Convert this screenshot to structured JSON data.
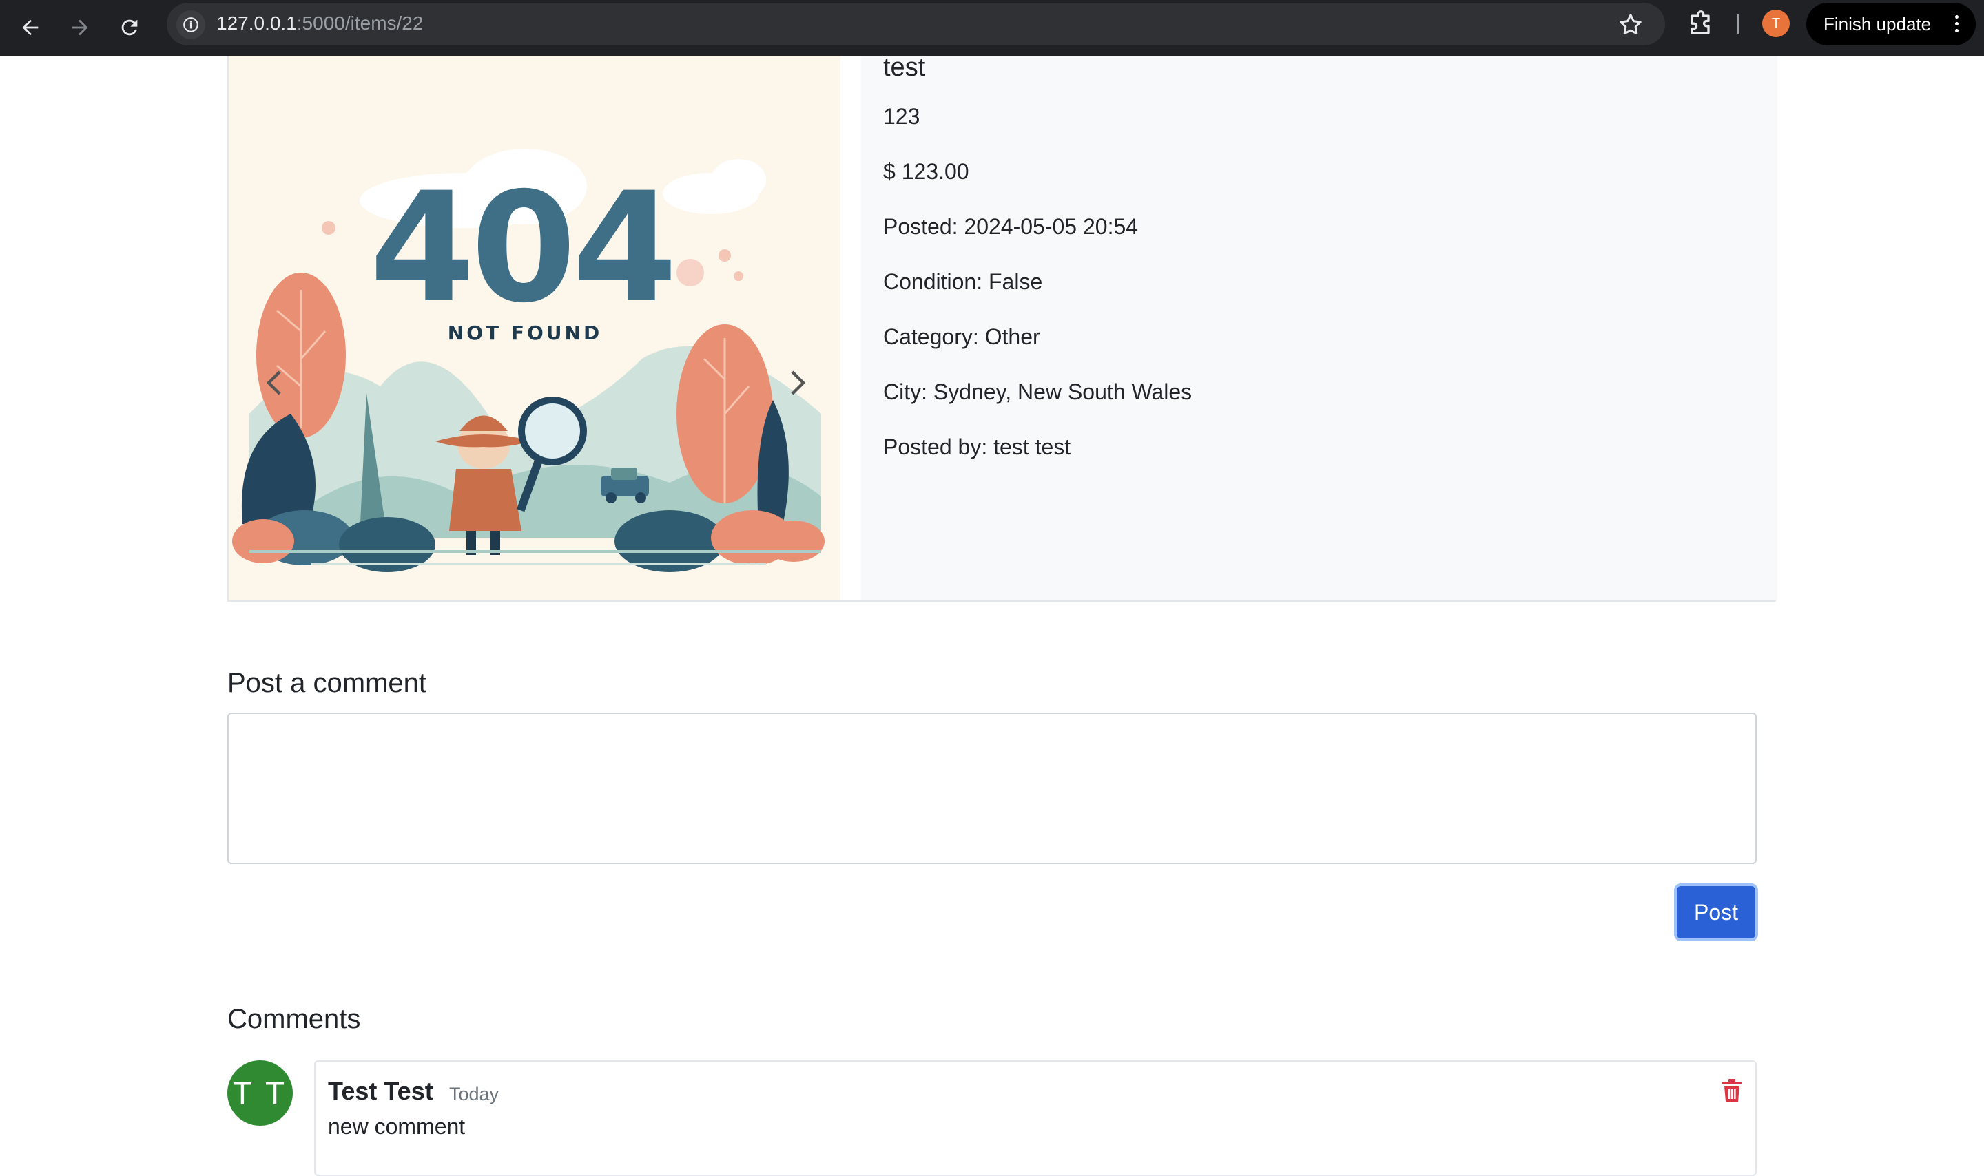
{
  "browser": {
    "url_host": "127.0.0.1",
    "url_path": ":5000/items/22",
    "profile_initial": "T",
    "finish_update_label": "Finish update"
  },
  "item": {
    "image_text_code": "404",
    "image_text_label": "NOT FOUND",
    "title": "test",
    "description": "123",
    "price": "$ 123.00",
    "posted": "Posted: 2024-05-05 20:54",
    "condition": "Condition: False",
    "category": "Category: Other",
    "city": "City: Sydney, New South Wales",
    "posted_by": "Posted by: test test"
  },
  "comment_form": {
    "heading": "Post a comment",
    "textarea_value": "",
    "post_label": "Post"
  },
  "comments": {
    "heading": "Comments",
    "items": [
      {
        "avatar_initials": "T T",
        "author": "Test Test",
        "time": "Today",
        "text": "new comment"
      }
    ]
  },
  "colors": {
    "chrome_bg": "#202124",
    "primary": "#2a61d6",
    "avatar_green": "#2f8a32",
    "delete_red": "#dc3545",
    "profile_orange": "#e8743b"
  },
  "icons": {
    "back": "back-arrow-icon",
    "forward": "forward-arrow-icon",
    "reload": "reload-icon",
    "site_info": "info-icon",
    "bookmark": "star-icon",
    "extensions": "puzzle-icon",
    "carousel_prev": "chevron-left-icon",
    "carousel_next": "chevron-right-icon",
    "delete": "trash-icon"
  }
}
